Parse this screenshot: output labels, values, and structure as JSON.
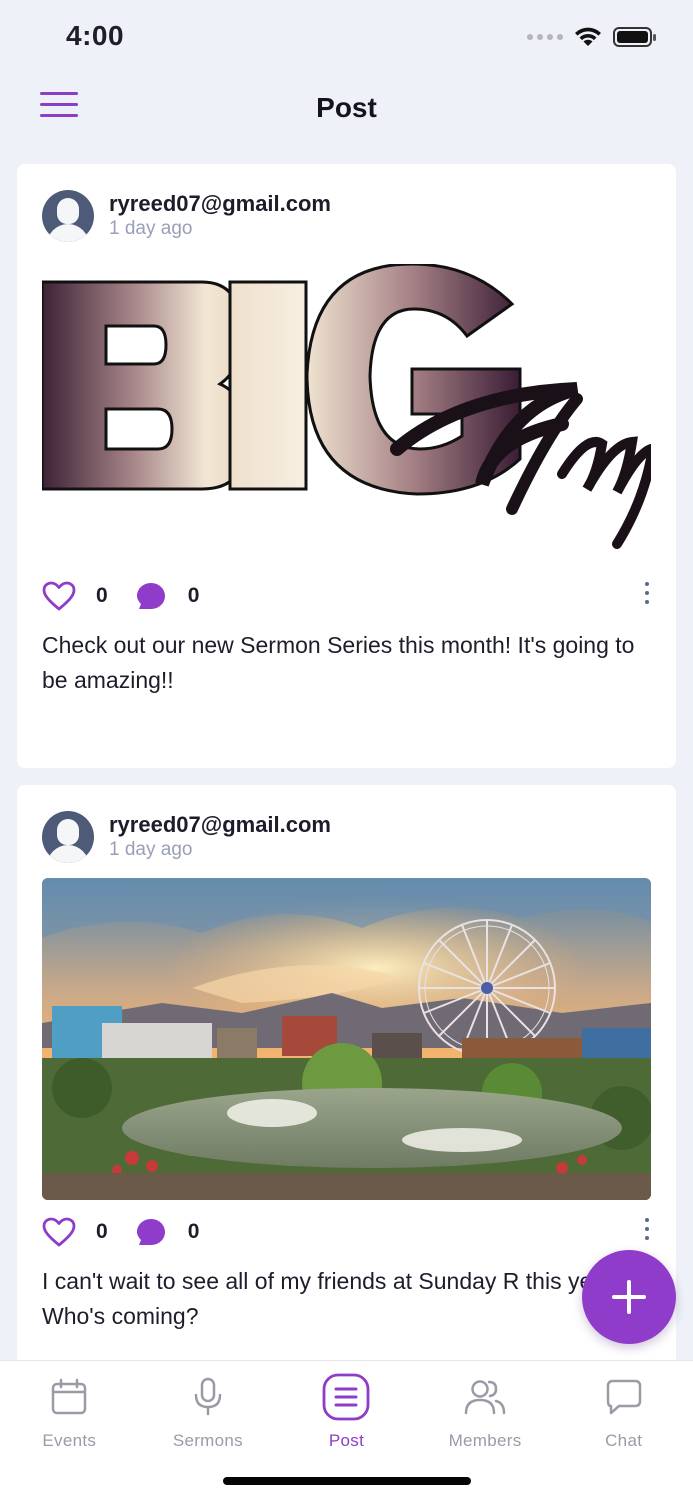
{
  "status_bar": {
    "time": "4:00"
  },
  "header": {
    "title": "Post"
  },
  "posts": [
    {
      "user": "ryreed07@gmail.com",
      "time": "1 day ago",
      "image": "big-things-graphic",
      "likes": "0",
      "comments": "0",
      "text": "Check out our new Sermon Series this month! It's going to be amazing!!"
    },
    {
      "user": "ryreed07@gmail.com",
      "time": "1 day ago",
      "image": "ferris-wheel-fountain-photo",
      "likes": "0",
      "comments": "0",
      "text": "I can't wait to see all of my friends at Sunday R this year!  Who's coming?"
    }
  ],
  "tabs": [
    {
      "label": "Events",
      "icon": "calendar-icon"
    },
    {
      "label": "Sermons",
      "icon": "microphone-icon"
    },
    {
      "label": "Post",
      "icon": "post-list-icon"
    },
    {
      "label": "Members",
      "icon": "members-icon"
    },
    {
      "label": "Chat",
      "icon": "chat-bubble-icon"
    }
  ],
  "active_tab": "Post",
  "colors": {
    "accent": "#8e3cc9",
    "background": "#eef1f8",
    "muted": "#9a9eb6"
  }
}
